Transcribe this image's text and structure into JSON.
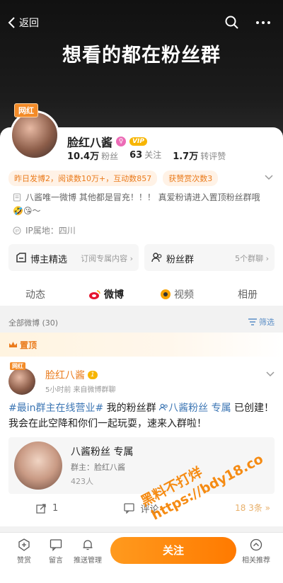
{
  "header": {
    "back_label": "返回",
    "banner_text": "想看的都在粉丝群"
  },
  "profile": {
    "tag": "网红",
    "name": "脸红八酱",
    "vip_badge": "VIP",
    "stats": [
      {
        "value": "10.4万",
        "label": "粉丝"
      },
      {
        "value": "63",
        "label": "关注"
      },
      {
        "value": "1.7万",
        "label": "转评赞"
      }
    ],
    "activity_pill": "昨日发博2，阅读数10万+，互动数857",
    "reward_pill": "获赞赏次数3",
    "description": "八酱唯一微博 其他都是冒充！！！ 真爱粉请进入置顶粉丝群哦",
    "emojis": "🤣😘～",
    "ip_location": "IP属地：四川",
    "cards": [
      {
        "title": "博主精选",
        "sub": "订阅专属内容 ›"
      },
      {
        "title": "粉丝群",
        "sub": "5个群聊 ›"
      }
    ],
    "tabs": [
      "动态",
      "微博",
      "视频",
      "相册"
    ]
  },
  "feed": {
    "all_label": "全部微博 (30)",
    "filter_label": "筛选",
    "pinned_label": "置顶"
  },
  "post": {
    "tag": "网红",
    "author": "脸红八酱",
    "level_badge": "1",
    "meta": "5小时前  来自微博群聊",
    "text_hashtag": "#最in群主在线营业#",
    "text_mid": " 我的粉丝群 ",
    "text_group_link": "八酱粉丝 专属",
    "text_end": " 已创建！我会在此空降和你们一起玩耍，速来入群啦！",
    "group_title": "八酱粉丝 专属",
    "group_owner": "群主：脸红八酱",
    "group_count": "423人",
    "repost_count": "1",
    "comment_label": "评论",
    "like_fragment": "18 3条 »"
  },
  "bottom_bar": {
    "items": [
      {
        "label": "赞赏"
      },
      {
        "label": "留言"
      },
      {
        "label": "推送管理"
      },
      {
        "label": "相关推荐"
      }
    ],
    "follow_label": "关注"
  },
  "watermark": {
    "line1": "黑料不打烊",
    "line2": "https://bdy18.co"
  },
  "colors": {
    "accent": "#ff8200",
    "link": "#3c76b4"
  }
}
